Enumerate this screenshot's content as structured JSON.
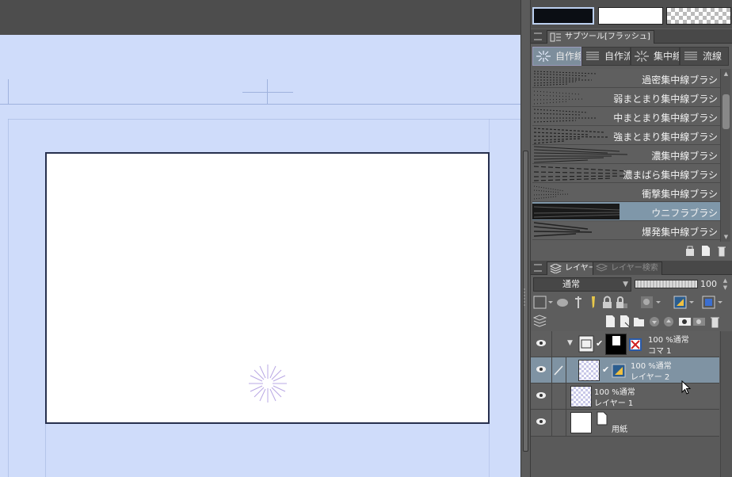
{
  "brush_palette": {
    "tab_label": "サブツール[フラッシュ]",
    "set_tabs": [
      "自作線",
      "自作流",
      "集中線",
      "流線"
    ],
    "items": [
      {
        "label": "過密集中線ブラシ",
        "selected": false
      },
      {
        "label": "弱まとまり集中線ブラシ",
        "selected": false
      },
      {
        "label": "中まとまり集中線ブラシ",
        "selected": false
      },
      {
        "label": "強まとまり集中線ブラシ",
        "selected": false
      },
      {
        "label": "濃集中線ブラシ",
        "selected": false
      },
      {
        "label": "濃まばら集中線ブラシ",
        "selected": false
      },
      {
        "label": "衝撃集中線ブラシ",
        "selected": false
      },
      {
        "label": "ウニフラブラシ",
        "selected": true
      },
      {
        "label": "爆発集中線ブラシ",
        "selected": false
      }
    ]
  },
  "layer_palette": {
    "tabs": {
      "layer": "レイヤー",
      "layer_search": "レイヤー検索"
    },
    "blend_mode": "通常",
    "opacity": "100",
    "layers": [
      {
        "line1": "100 %通常",
        "line2": "コマ 1",
        "type": "frame-folder",
        "selected": false
      },
      {
        "line1": "100 %通常",
        "line2": "レイヤー 2",
        "type": "raster",
        "selected": true
      },
      {
        "line1": "100 %通常",
        "line2": "レイヤー 1",
        "type": "raster",
        "selected": false
      },
      {
        "line1": "",
        "line2": "用紙",
        "type": "paper",
        "selected": false
      }
    ]
  },
  "colors": {
    "canvas_bg": "#cfdcfa",
    "panel_bg": "#5d5d5d",
    "selected_row": "#7f93a3",
    "main_color": "#0b0e14",
    "sub_color": "#ffffff"
  }
}
